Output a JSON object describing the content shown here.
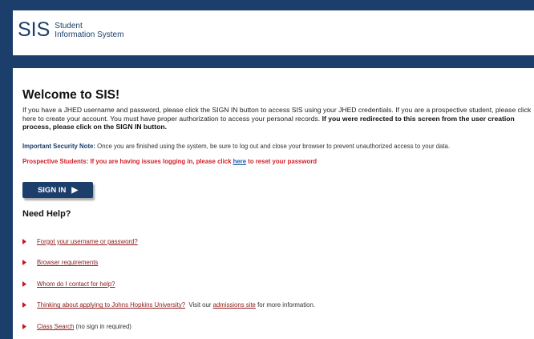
{
  "header": {
    "logo_text": "SIS",
    "logo_subtitle_line1": "Student",
    "logo_subtitle_line2": "Information System"
  },
  "main": {
    "title": "Welcome to SIS!",
    "intro_text": "If you have a JHED username and password, please click the SIGN IN button to access SIS using your JHED credentials. If you are a prospective student, please click here to create your account. You must have proper authorization to access your personal records.",
    "intro_bold": " If you were redirected to this screen from the user creation process, please click on the SIGN IN button.",
    "security_label": "Important Security Note:",
    "security_text": "  Once you are finished using the system, be sure to log out and close your browser to prevent unauthorized access to your data.",
    "prospect_text": "Prospective Students: If you are having issues logging in, please click ",
    "prospect_link": "here",
    "prospect_suffix": " to reset your password",
    "signin_label": "SIGN IN",
    "help_title": "Need Help?",
    "help_items": [
      {
        "link": "Forgot your username or password?",
        "suffix": ""
      },
      {
        "link": "Browser requirements",
        "suffix": ""
      },
      {
        "link": "Whom do I contact for help?",
        "suffix": ""
      },
      {
        "link": "Thinking about applying to Johns Hopkins University?",
        "mid": "  Visit our ",
        "link2": "admissions site",
        "suffix": " for more information."
      },
      {
        "link": "Class Search",
        "suffix": " (no sign in required)"
      }
    ]
  },
  "colors": {
    "navy": "#1b3e6b",
    "alert_red": "#d4202a",
    "bullet_red": "#c4161c",
    "link_maroon": "#8b1a1a"
  }
}
